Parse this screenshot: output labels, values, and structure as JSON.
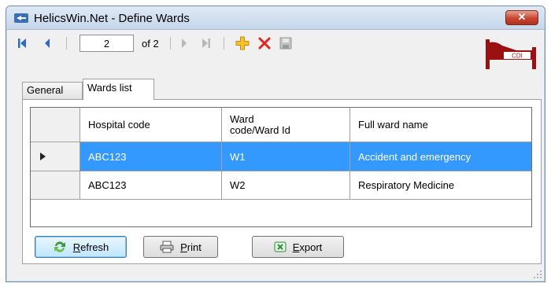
{
  "window": {
    "title": "HelicsWin.Net - Define Wards",
    "close_label": "✕"
  },
  "navigator": {
    "current_page": "2",
    "of_label": "of 2"
  },
  "tabs": [
    {
      "label": "General",
      "active": false
    },
    {
      "label": "Wards list",
      "active": true
    }
  ],
  "logo": {
    "text": "CDI",
    "color": "#9b1111"
  },
  "table": {
    "columns": [
      "Hospital code",
      "Ward code/Ward Id",
      "Full ward name"
    ],
    "columns_display": {
      "c0": "Hospital code",
      "c1_line1": "Ward",
      "c1_line2": "code/Ward Id",
      "c2": "Full ward name"
    },
    "rows": [
      {
        "hospital_code": "ABC123",
        "ward_code": "W1",
        "full_name": "Accident and emergency",
        "selected": true
      },
      {
        "hospital_code": "ABC123",
        "ward_code": "W2",
        "full_name": "Respiratory Medicine",
        "selected": false
      }
    ],
    "selection_color": "#3399ff"
  },
  "buttons": {
    "refresh": "Refresh",
    "print": "Print",
    "export": "Export"
  }
}
